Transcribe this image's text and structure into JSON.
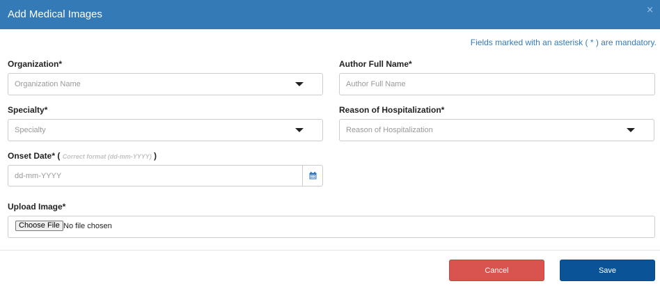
{
  "dialog": {
    "title": "Add Medical Images",
    "close_symbol": "×"
  },
  "mandatory_note": "Fields marked with an asterisk ( * ) are mandatory.",
  "fields": {
    "organization": {
      "label": "Organization*",
      "placeholder": "Organization Name"
    },
    "author": {
      "label": "Author Full Name*",
      "placeholder": "Author Full Name"
    },
    "specialty": {
      "label": "Specialty*",
      "placeholder": "Specialty"
    },
    "reason": {
      "label": "Reason of Hospitalization*",
      "placeholder": "Reason of Hospitalization"
    },
    "onset_date": {
      "label": "Onset Date*",
      "paren_open": " ( ",
      "hint": "Correct format (dd-mm-YYYY)",
      "paren_close": " )",
      "placeholder": "dd-mm-YYYY"
    },
    "upload": {
      "label": "Upload Image*",
      "choose_label": "Choose File",
      "status": "No file chosen"
    }
  },
  "buttons": {
    "cancel": "Cancel",
    "save": "Save"
  },
  "icons": {
    "dropdown": "caret-down-icon",
    "calendar": "calendar-icon",
    "close": "close-icon"
  },
  "colors": {
    "header": "#337ab7",
    "cancel": "#d9534f",
    "save": "#0a5397",
    "note": "#337ab7"
  }
}
